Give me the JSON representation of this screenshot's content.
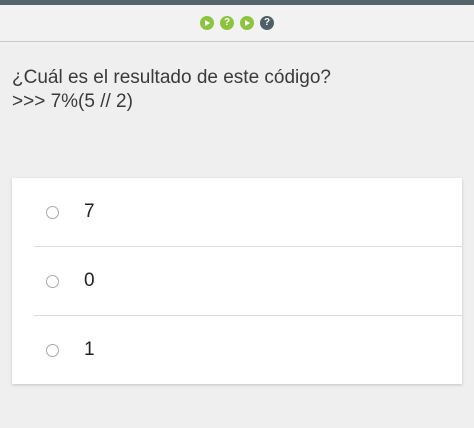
{
  "progress": {
    "steps": [
      {
        "icon": "play-icon",
        "color": "#8dc43f"
      },
      {
        "icon": "question-icon",
        "color": "#8dc43f",
        "label": "?"
      },
      {
        "icon": "play-icon",
        "color": "#8dc43f"
      },
      {
        "icon": "question-icon",
        "color": "#4f5f68",
        "label": "?"
      }
    ]
  },
  "question": {
    "line1": "¿Cuál es el resultado de este código?",
    "line2": ">>> 7%(5 // 2)"
  },
  "options": [
    {
      "label": "7"
    },
    {
      "label": "0"
    },
    {
      "label": "1"
    }
  ]
}
